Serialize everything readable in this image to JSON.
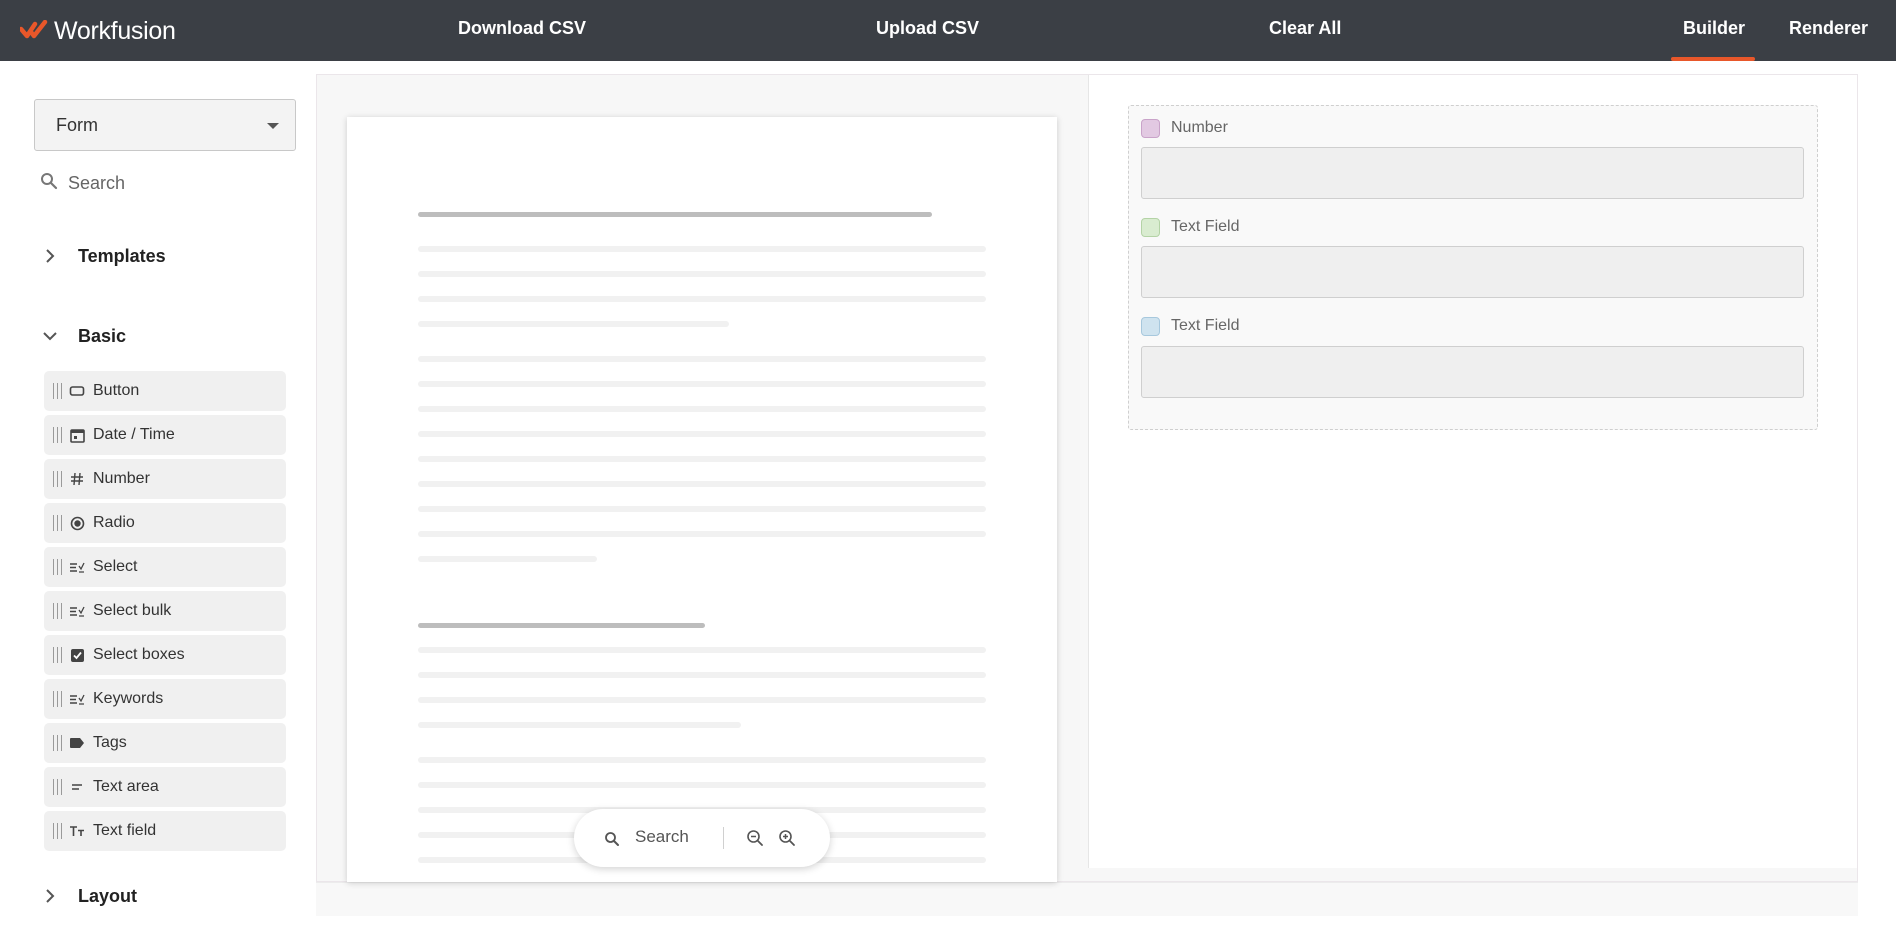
{
  "app": {
    "brand": "Workfusion",
    "accent_color": "#e8572a",
    "topbar_color": "#3b3f45"
  },
  "toolbar": {
    "download_label": "Download CSV",
    "upload_label": "Upload CSV",
    "clear_label": "Clear All",
    "builder_tab": "Builder",
    "renderer_tab": "Renderer",
    "active_tab": "Builder"
  },
  "sidebar": {
    "form_select_value": "Form",
    "search_placeholder": "Search",
    "sections": {
      "templates": "Templates",
      "basic": "Basic",
      "layout": "Layout"
    },
    "components": [
      {
        "label": "Button",
        "icon": "button-icon"
      },
      {
        "label": "Date / Time",
        "icon": "calendar-icon"
      },
      {
        "label": "Number",
        "icon": "hash-icon"
      },
      {
        "label": "Radio",
        "icon": "radio-icon"
      },
      {
        "label": "Select",
        "icon": "select-list-icon"
      },
      {
        "label": "Select bulk",
        "icon": "select-list-icon"
      },
      {
        "label": "Select boxes",
        "icon": "checkbox-icon"
      },
      {
        "label": "Keywords",
        "icon": "select-list-icon"
      },
      {
        "label": "Tags",
        "icon": "tag-icon"
      },
      {
        "label": "Text area",
        "icon": "text-area-icon"
      },
      {
        "label": "Text field",
        "icon": "text-field-icon"
      }
    ]
  },
  "document": {
    "search_label": "Search"
  },
  "form_fields": [
    {
      "label": "Number",
      "swatch_fill": "#e2c9e2",
      "swatch_border": "#c9a3c9"
    },
    {
      "label": "Text Field",
      "swatch_fill": "#d9ecd0",
      "swatch_border": "#b4d3a6"
    },
    {
      "label": "Text Field",
      "swatch_fill": "#cfe3ef",
      "swatch_border": "#a7c8dd"
    }
  ]
}
